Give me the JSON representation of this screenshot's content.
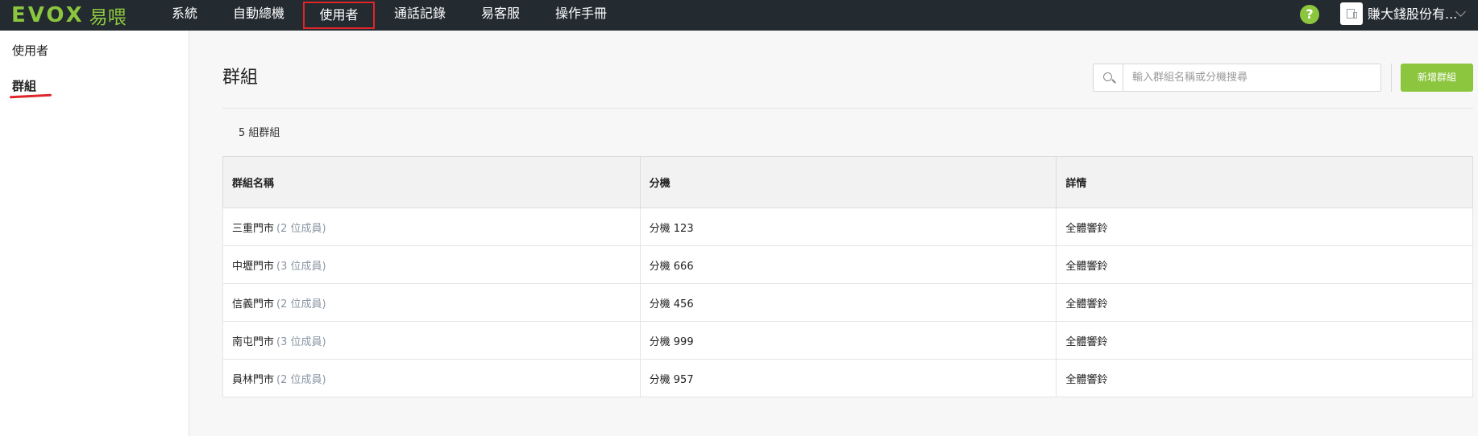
{
  "topbar": {
    "logo": "EVOX",
    "logo_sub": "易喂",
    "nav": [
      {
        "label": "系統",
        "active": false
      },
      {
        "label": "自動總機",
        "active": false
      },
      {
        "label": "使用者",
        "active": true
      },
      {
        "label": "通話記錄",
        "active": false
      },
      {
        "label": "易客服",
        "active": false
      },
      {
        "label": "操作手冊",
        "active": false
      }
    ],
    "help": "?",
    "company": "賺大錢股份有..."
  },
  "sidebar": {
    "items": [
      {
        "label": "使用者",
        "active": false
      },
      {
        "label": "群組",
        "active": true
      }
    ]
  },
  "main": {
    "title": "群組",
    "search_placeholder": "輸入群組名稱或分機搜尋",
    "add_button": "新增群組",
    "count": "5 組群組",
    "table": {
      "headers": [
        "群組名稱",
        "分機",
        "詳情"
      ],
      "rows": [
        {
          "name": "三重門市",
          "members": "(2 位成員)",
          "ext": "分機 123",
          "detail": "全體響鈴"
        },
        {
          "name": "中壢門市",
          "members": "(3 位成員)",
          "ext": "分機 666",
          "detail": "全體響鈴"
        },
        {
          "name": "信義門市",
          "members": "(2 位成員)",
          "ext": "分機 456",
          "detail": "全體響鈴"
        },
        {
          "name": "南屯門市",
          "members": "(3 位成員)",
          "ext": "分機 999",
          "detail": "全體響鈴"
        },
        {
          "name": "員林門市",
          "members": "(2 位成員)",
          "ext": "分機 957",
          "detail": "全體響鈴"
        }
      ]
    }
  },
  "colors": {
    "accent": "#8cc63f",
    "topbar": "#232a30",
    "highlight": "#e0262b"
  }
}
